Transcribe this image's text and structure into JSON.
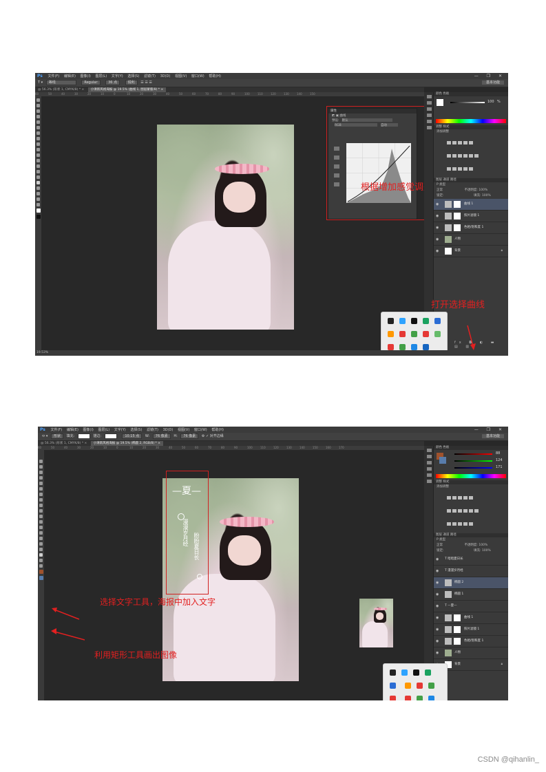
{
  "shot1": {
    "menu": {
      "logo": "Ps",
      "items": [
        "文件(F)",
        "编辑(E)",
        "图像(I)",
        "图层(L)",
        "文字(Y)",
        "选择(S)",
        "滤镜(T)",
        "3D(D)",
        "视图(V)",
        "窗口(W)",
        "帮助(H)"
      ],
      "window_controls": "— ❐ ✕"
    },
    "options": {
      "tool": "T ▾",
      "font_family": "等线",
      "font_style": "Regular",
      "font_size": "36 点",
      "antialias": "锐利",
      "workspace": "基本功能"
    },
    "tabs": [
      "@ 56.3% (形状 1, CMYK/8) * ×",
      "小清新风格海报 @ 19.5% (曲线 1, 图层蒙版/8) * ×"
    ],
    "ruler": [
      "60",
      "50",
      "40",
      "30",
      "20",
      "10",
      "0",
      "10",
      "20",
      "30",
      "40",
      "50",
      "60",
      "70",
      "80",
      "90",
      "100",
      "110",
      "120",
      "130",
      "140",
      "150"
    ],
    "status": "19.53%",
    "color_panel": {
      "tabs": "颜色  色板",
      "value": "100",
      "pct": "%"
    },
    "adjust_panel": {
      "tabs": "调整  样式",
      "subtitle": "添加调整"
    },
    "layers_panel": {
      "tabs": "图层  通道  路径",
      "kind": "P 类型",
      "blend": "正常",
      "opacity_label": "不透明度:",
      "opacity": "100%",
      "lock_label": "锁定:",
      "fill_label": "填充:",
      "fill": "100%",
      "layers": [
        {
          "name": "曲线 1",
          "selected": true
        },
        {
          "name": "照片滤镜 1",
          "selected": false
        },
        {
          "name": "色相/饱和度 1",
          "selected": false
        },
        {
          "name": "人物",
          "selected": false
        },
        {
          "name": "背景",
          "selected": false
        }
      ]
    },
    "properties_panel": {
      "title": "属性",
      "sub": "曲线",
      "preset_label": "预设:",
      "preset": "默认",
      "channel": "RGB",
      "auto": "自动"
    },
    "annotations": {
      "curve_note": "根据增加感觉调整",
      "open_note": "打开选择曲线"
    }
  },
  "shot2": {
    "menu": {
      "logo": "Ps",
      "items": [
        "文件(F)",
        "编辑(E)",
        "图像(I)",
        "图层(L)",
        "文字(Y)",
        "选择(S)",
        "滤镜(T)",
        "3D(D)",
        "视图(V)",
        "窗口(W)",
        "帮助(H)"
      ],
      "window_controls": "— ❐ ✕"
    },
    "options": {
      "shape_mode": "形状",
      "fill_label": "填充:",
      "stroke_label": "描边:",
      "stroke_size": "10.15 点",
      "w_label": "W:",
      "w": "76 像素",
      "h_label": "H:",
      "h": "76 像素",
      "align_edges": "对齐边缘",
      "workspace": "基本功能"
    },
    "tabs": [
      "@ 56.3% (形状 1, CMYK/8) * ×",
      "小清新风格海报 @ 19.5% (椭圆 2, RGB/8) * ×"
    ],
    "ruler": [
      "60",
      "50",
      "40",
      "30",
      "20",
      "10",
      "0",
      "10",
      "20",
      "30",
      "40",
      "50",
      "60",
      "70",
      "80",
      "90",
      "100",
      "110",
      "120",
      "130",
      "140",
      "150",
      "160",
      "170"
    ],
    "color_panel": {
      "tabs": "颜色  色板",
      "r": "88",
      "g": "124",
      "b": "171"
    },
    "adjust_panel": {
      "tabs": "调整  样式",
      "subtitle": "添加调整"
    },
    "layers_panel": {
      "tabs": "图层  通道  路径",
      "kind": "P 类型",
      "blend": "正常",
      "opacity_label": "不透明度:",
      "opacity": "100%",
      "lock_label": "锁定:",
      "fill_label": "填充:",
      "fill": "100%",
      "layers": [
        {
          "name": "T  暗暗夏日长",
          "selected": false
        },
        {
          "name": "T  漫漫岁月经",
          "selected": false
        },
        {
          "name": "椭圆 2",
          "selected": true
        },
        {
          "name": "椭圆 1",
          "selected": false
        },
        {
          "name": "T  —夏—",
          "selected": false
        },
        {
          "name": "曲线 1",
          "selected": false
        },
        {
          "name": "照片滤镜 1",
          "selected": false
        },
        {
          "name": "色相/饱和度 1",
          "selected": false
        },
        {
          "name": "人物",
          "selected": false
        },
        {
          "name": "背景",
          "selected": false
        }
      ]
    },
    "poster_text": {
      "title": "—夏—",
      "col1": "漫漫岁月经",
      "col2": "盼盼夏日长"
    },
    "annotations": {
      "text_note": "选择文字工具，海报中加入文字",
      "rect_note": "利用矩形工具画出图像"
    }
  },
  "footer": "CSDN @qihanlin_"
}
